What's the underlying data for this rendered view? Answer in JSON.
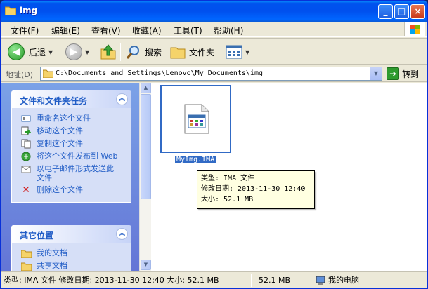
{
  "window": {
    "title": "img"
  },
  "menu": [
    "文件(F)",
    "编辑(E)",
    "查看(V)",
    "收藏(A)",
    "工具(T)",
    "帮助(H)"
  ],
  "toolbar": {
    "back": "后退",
    "search": "搜索",
    "folders": "文件夹"
  },
  "address": {
    "label": "地址(D)",
    "path": "C:\\Documents and Settings\\Lenovo\\My Documents\\img",
    "go": "转到"
  },
  "tasks": {
    "file_title": "文件和文件夹任务",
    "file_items": [
      "重命名这个文件",
      "移动这个文件",
      "复制这个文件",
      "将这个文件发布到 Web",
      "以电子邮件形式发送此文件",
      "删除这个文件"
    ],
    "other_title": "其它位置",
    "other_items": [
      "我的文档",
      "共享文档"
    ]
  },
  "file": {
    "name": "MyImg.IMA"
  },
  "tooltip": {
    "type": "类型: IMA 文件",
    "modified": "修改日期: 2013-11-30 12:40",
    "size": "大小: 52.1 MB"
  },
  "status": {
    "info": "类型: IMA 文件 修改日期: 2013-11-30 12:40 大小: 52.1 MB",
    "size": "52.1 MB",
    "location": "我的电脑"
  },
  "icons": {
    "folder": "folder-icon",
    "back": "back-arrow-icon",
    "forward": "forward-arrow-icon",
    "up": "up-folder-icon",
    "search": "magnifier-icon",
    "views": "views-icon",
    "rename": "rename-icon",
    "move": "move-icon",
    "copy": "copy-icon",
    "publish": "publish-web-icon",
    "email": "email-icon",
    "delete": "delete-x-icon",
    "computer": "my-computer-icon"
  },
  "colors": {
    "titlebar": "#0053ee",
    "taskpane": "#6f89e0",
    "task_link": "#215dc6",
    "selection": "#316ac5",
    "tooltip_bg": "#ffffe1"
  }
}
